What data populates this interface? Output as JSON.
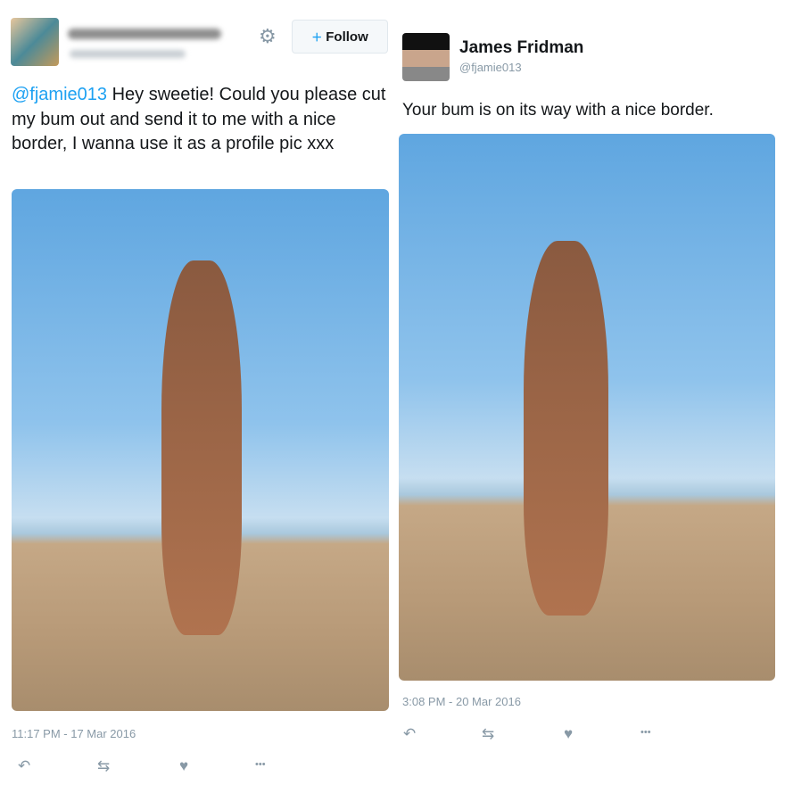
{
  "left_tweet": {
    "follow_label": "Follow",
    "mention": "@fjamie013",
    "text": " Hey sweetie! Could you please cut my bum out and send it to me with a nice border, I wanna use it as a profile pic xxx",
    "timestamp": "11:17 PM - 17 Mar 2016"
  },
  "right_tweet": {
    "name": "James Fridman",
    "handle": "@fjamie013",
    "text": "Your bum is on its way with a nice border.",
    "timestamp": "3:08 PM - 20 Mar 2016"
  },
  "icons": {
    "reply": "↶",
    "retweet": "⇆",
    "like": "♥",
    "more": "•••",
    "gear": "⚙",
    "follow": "👤+"
  },
  "colors": {
    "link": "#1da1f2",
    "meta": "#8899a6"
  }
}
